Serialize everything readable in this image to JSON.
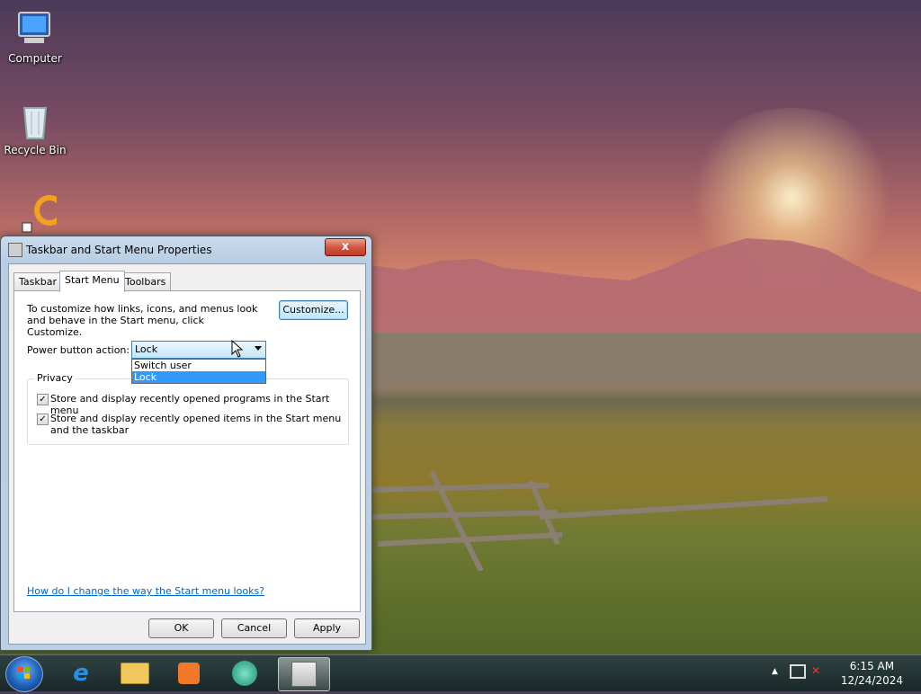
{
  "desktop": {
    "icons": [
      {
        "label": "Computer"
      },
      {
        "label": "Recycle Bin"
      },
      {
        "label": ""
      }
    ]
  },
  "dialog": {
    "title": "Taskbar and Start Menu Properties",
    "close_label": "x",
    "tabs": [
      {
        "label": "Taskbar"
      },
      {
        "label": "Start Menu"
      },
      {
        "label": "Toolbars"
      }
    ],
    "description": "To customize how links, icons, and menus look and behave in the Start menu, click Customize.",
    "customize_label": "Customize...",
    "power_label": "Power button action:",
    "power_value": "Lock",
    "power_options": [
      "Switch user",
      "Lock"
    ],
    "privacy_label": "Privacy",
    "checkbox1": "Store and display recently opened programs in the Start menu",
    "checkbox2": "Store and display recently opened items in the Start menu and the taskbar",
    "help_link": "How do I change the way the Start menu looks?",
    "ok_label": "OK",
    "cancel_label": "Cancel",
    "apply_label": "Apply"
  },
  "taskbar": {
    "time": "6:15 AM",
    "date": "12/24/2024",
    "pinned": [
      "start-orb",
      "ie-icon",
      "explorer-icon",
      "media-player-icon",
      "browser-icon",
      "properties-icon"
    ]
  }
}
